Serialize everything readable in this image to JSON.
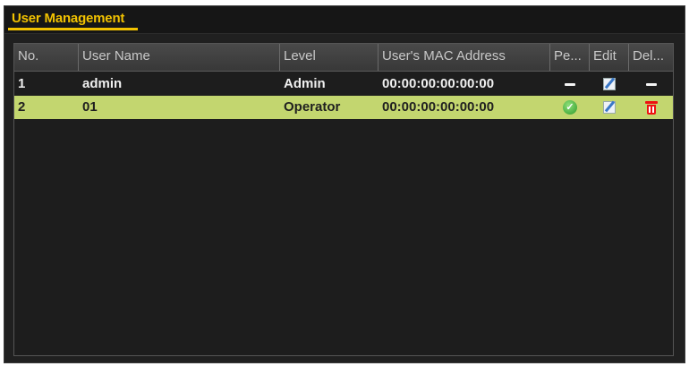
{
  "window": {
    "title": "User Management"
  },
  "table": {
    "columns": [
      "No.",
      "User Name",
      "Level",
      "User's MAC Address",
      "Pe...",
      "Edit",
      "Del..."
    ],
    "rows": [
      {
        "no": "1",
        "user_name": "admin",
        "level": "Admin",
        "mac": "00:00:00:00:00:00",
        "permission_icon": "dash-icon",
        "edit_icon": "edit-icon",
        "delete_icon": "dash-icon",
        "selected": false
      },
      {
        "no": "2",
        "user_name": "01",
        "level": "Operator",
        "mac": "00:00:00:00:00:00",
        "permission_icon": "check-icon",
        "edit_icon": "edit-icon",
        "delete_icon": "trash-icon",
        "selected": true
      }
    ]
  },
  "colors": {
    "accent": "#f2c200",
    "selected_row": "#c3d66f",
    "background": "#202020",
    "delete": "#e11111",
    "permission_ok": "#2e9a2a"
  }
}
